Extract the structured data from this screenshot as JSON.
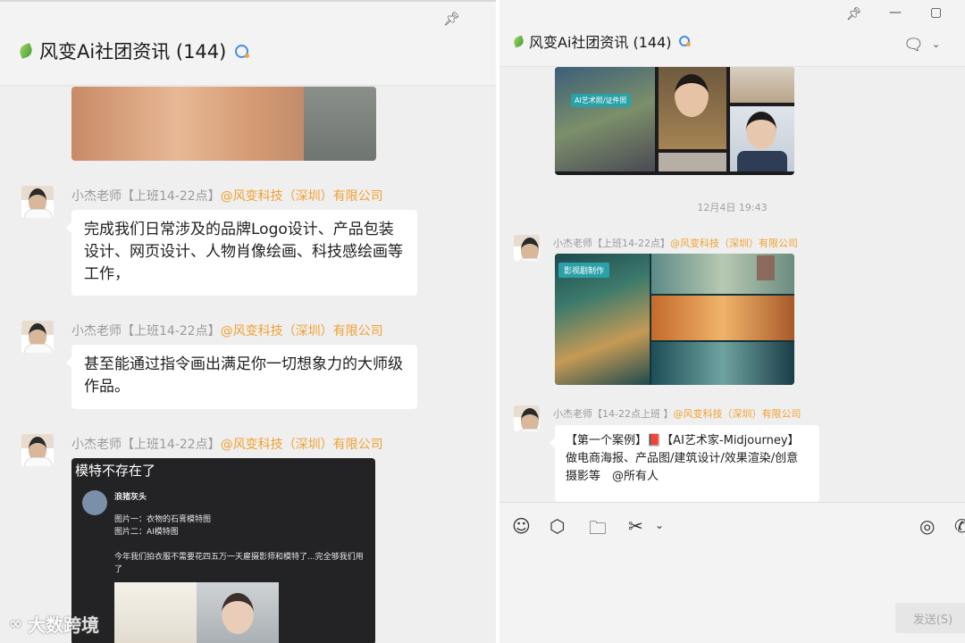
{
  "left": {
    "title": "风变Ai社团资讯 (144)",
    "messages": [
      {
        "sender_name": "小杰老师【上班14-22点】",
        "sender_org": "@风变科技（深圳）有限公司",
        "text": "完成我们日常涉及的品牌Logo设计、产品包装设计、网页设计、人物肖像绘画、科技感绘画等工作，"
      },
      {
        "sender_name": "小杰老师【上班14-22点】",
        "sender_org": "@风变科技（深圳）有限公司",
        "text": "甚至能通过指令画出满足你一切想象力的大师级作品。"
      },
      {
        "sender_name": "小杰老师【上班14-22点】",
        "sender_org": "@风变科技（深圳）有限公司",
        "card_title": "模特不存在了",
        "post_user": "浪猪灰头",
        "post_line1": "图片一：衣物的石膏模特图",
        "post_line2": "图片二：AI模特图",
        "post_body": "今年我们拍衣服不需要花四五万一天雇摄影师和模特了...完全够我们用了"
      }
    ]
  },
  "right": {
    "title": "风变Ai社团资讯 (144)",
    "image1_tag": "AI艺术照/证件照",
    "timestamp": "12月4日 19:43",
    "msg1": {
      "sender_name": "小杰老师【上班14-22点】",
      "sender_org": "@风变科技（深圳）有限公司",
      "image_tag": "影视剧制作"
    },
    "msg2": {
      "sender_name": "小杰老师【14-22点上班 】",
      "sender_org": "@风变科技（深圳）有限公司",
      "text": "【第一个案例】📕【AI艺术家-Midjourney】做电商海报、产品图/建筑设计/效果渲染/创意摄影等　@所有人"
    },
    "send_label": "发送(S)"
  },
  "icons": {
    "pin": "pin-icon",
    "emoji": "emoji-icon",
    "cube": "cube-icon",
    "folder": "folder-icon",
    "scissors": "scissors-icon",
    "chat": "chat-icon"
  },
  "watermark": "大数跨境",
  "colors": {
    "org": "#f0a030",
    "sender": "#9a9a9a",
    "pane_bg": "#efefef"
  }
}
